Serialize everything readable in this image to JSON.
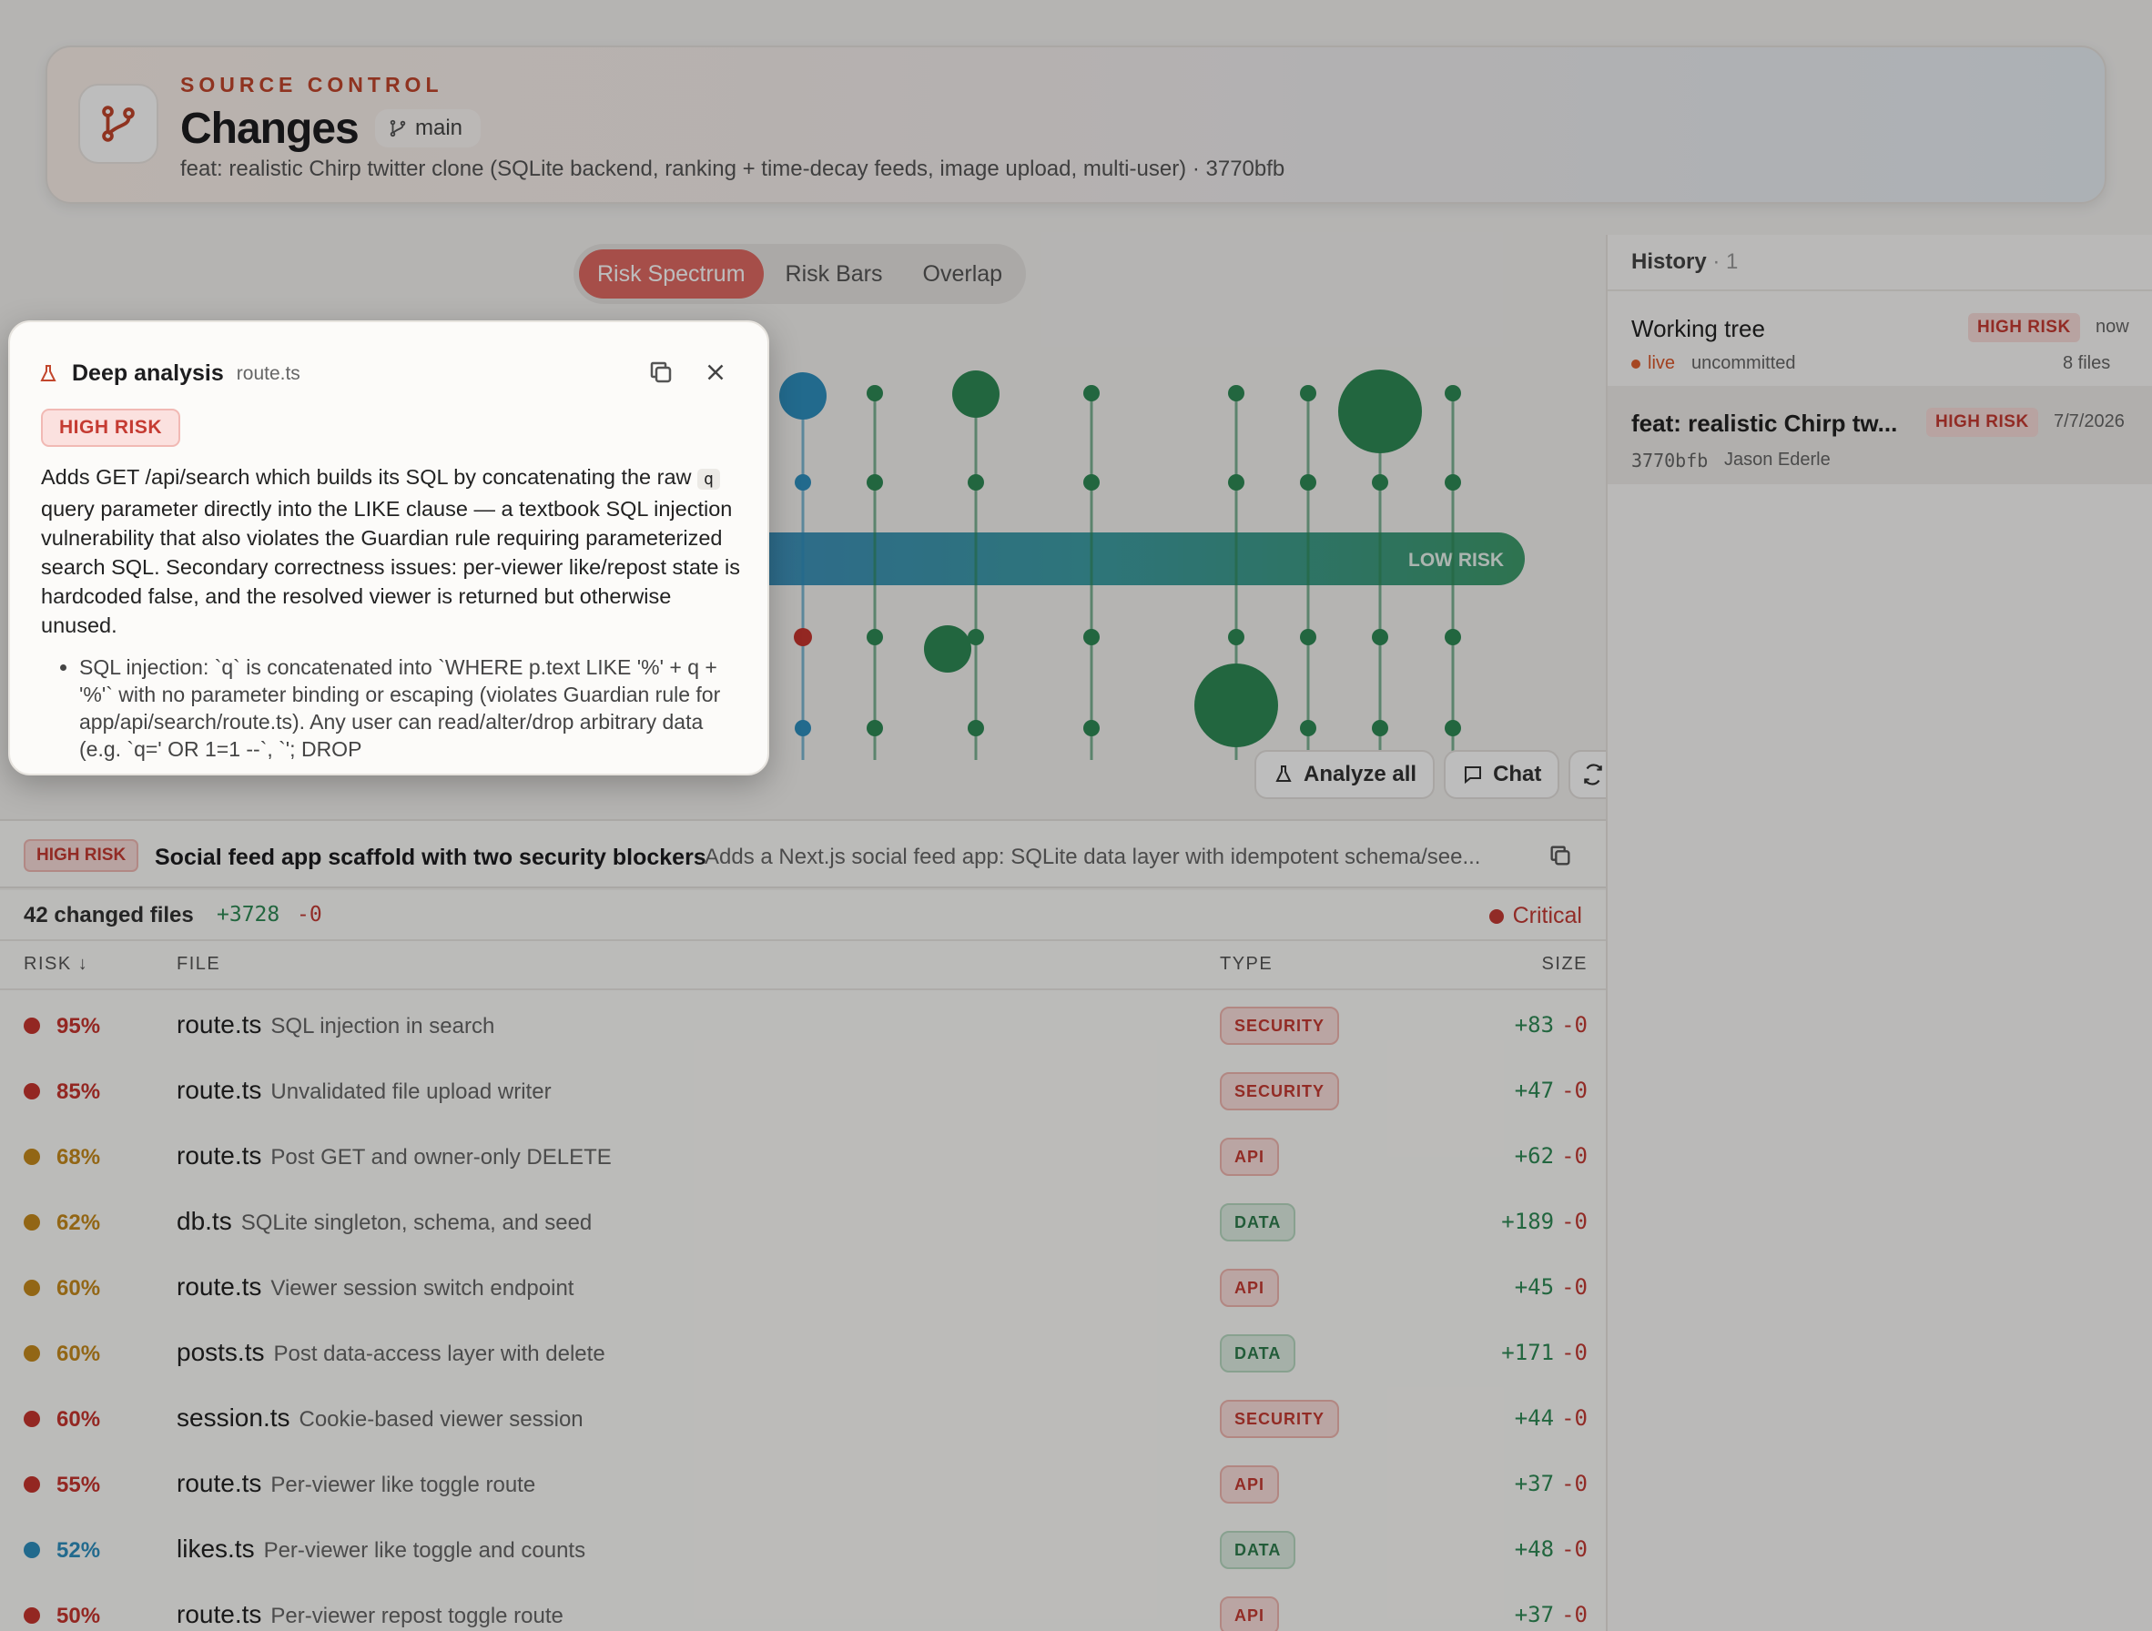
{
  "header": {
    "eyebrow": "SOURCE CONTROL",
    "title": "Changes",
    "branch": "main",
    "commit_message": "feat: realistic Chirp twitter clone (SQLite backend, ranking + time-decay feeds, image upload, multi-user) · 3770bfb"
  },
  "tabs": [
    {
      "label": "Risk Spectrum",
      "active": true
    },
    {
      "label": "Risk Bars",
      "active": false
    },
    {
      "label": "Overlap",
      "active": false
    }
  ],
  "chart": {
    "band_label": "LOW RISK",
    "analyze_all": "Analyze all",
    "chat": "Chat"
  },
  "panel": {
    "title": "Deep analysis",
    "file": "route.ts",
    "badge": "HIGH RISK",
    "summary_a": "Adds GET /api/search which builds its SQL by concatenating the raw",
    "summary_code": "q",
    "summary_b": "query parameter directly into the LIKE clause — a textbook SQL injection vulnerability that also violates the Guardian rule requiring parameterized search SQL. Secondary correctness issues: per-viewer like/repost state is hardcoded false, and the resolved viewer is returned but otherwise unused.",
    "bullets": [
      "SQL injection: `q` is concatenated into `WHERE p.text LIKE '%' + q + '%'` with no parameter binding or escaping (violates Guardian rule for app/api/search/route.ts). Any user can read/alter/drop arbitrary data (e.g. `q=' OR 1=1 --`, `'; DROP"
    ]
  },
  "history": {
    "title": "History",
    "count": "· 1",
    "items": [
      {
        "title": "Working tree",
        "badge": "HIGH RISK",
        "time": "now",
        "status": "live",
        "sub": "uncommitted",
        "files": "8 files"
      },
      {
        "title": "feat: realistic Chirp tw...",
        "badge": "HIGH RISK",
        "time": "7/7/2026",
        "hash": "3770bfb",
        "author": "Jason Ederle"
      }
    ]
  },
  "summary": {
    "badge": "HIGH RISK",
    "title": "Social feed app scaffold with two security blockers",
    "description": "Adds a Next.js social feed app: SQLite data layer with idempotent schema/see..."
  },
  "files_bar": {
    "count": "42 changed files",
    "additions": "+3728",
    "deletions": "-0",
    "critical": "Critical"
  },
  "table": {
    "headers": {
      "risk": "RISK",
      "file": "FILE",
      "type": "TYPE",
      "size": "SIZE"
    },
    "rows": [
      {
        "pct": "95%",
        "level": "red",
        "name": "route.ts",
        "desc": "SQL injection in search",
        "type": "SECURITY",
        "kind": "security",
        "add": "+83",
        "del": "-0"
      },
      {
        "pct": "85%",
        "level": "red",
        "name": "route.ts",
        "desc": "Unvalidated file upload writer",
        "type": "SECURITY",
        "kind": "security",
        "add": "+47",
        "del": "-0"
      },
      {
        "pct": "68%",
        "level": "amber",
        "name": "route.ts",
        "desc": "Post GET and owner-only DELETE",
        "type": "API",
        "kind": "api",
        "add": "+62",
        "del": "-0"
      },
      {
        "pct": "62%",
        "level": "amber",
        "name": "db.ts",
        "desc": "SQLite singleton, schema, and seed",
        "type": "DATA",
        "kind": "data",
        "add": "+189",
        "del": "-0"
      },
      {
        "pct": "60%",
        "level": "amber",
        "name": "route.ts",
        "desc": "Viewer session switch endpoint",
        "type": "API",
        "kind": "api",
        "add": "+45",
        "del": "-0"
      },
      {
        "pct": "60%",
        "level": "amber",
        "name": "posts.ts",
        "desc": "Post data-access layer with delete",
        "type": "DATA",
        "kind": "data",
        "add": "+171",
        "del": "-0"
      },
      {
        "pct": "60%",
        "level": "red",
        "name": "session.ts",
        "desc": "Cookie-based viewer session",
        "type": "SECURITY",
        "kind": "security",
        "add": "+44",
        "del": "-0"
      },
      {
        "pct": "55%",
        "level": "red",
        "name": "route.ts",
        "desc": "Per-viewer like toggle route",
        "type": "API",
        "kind": "api",
        "add": "+37",
        "del": "-0"
      },
      {
        "pct": "52%",
        "level": "blue",
        "name": "likes.ts",
        "desc": "Per-viewer like toggle and counts",
        "type": "DATA",
        "kind": "data",
        "add": "+48",
        "del": "-0"
      },
      {
        "pct": "50%",
        "level": "red",
        "name": "route.ts",
        "desc": "Per-viewer repost toggle route",
        "type": "API",
        "kind": "api",
        "add": "+37",
        "del": "-0"
      }
    ]
  },
  "colors": {
    "red": "#c7352e",
    "amber": "#c68a1d",
    "blue": "#2f8fbf",
    "green": "#2f8a55",
    "accent": "#e06a63"
  }
}
